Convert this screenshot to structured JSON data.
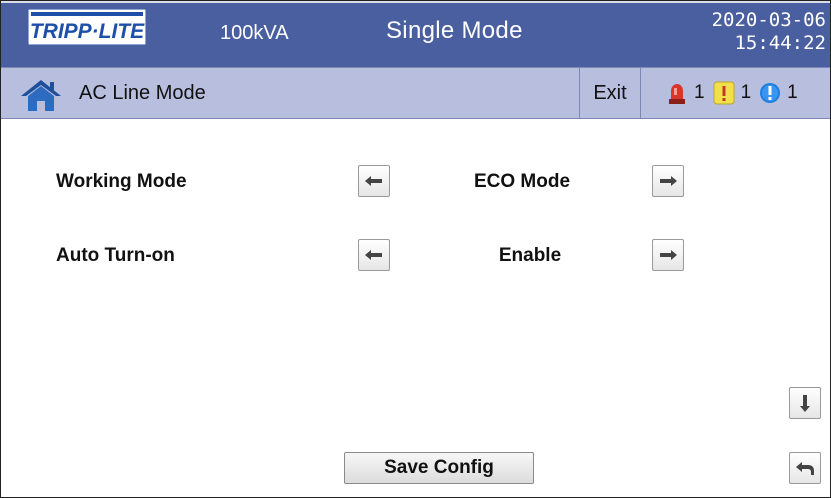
{
  "header": {
    "logo_text": "TRIPP·LITE",
    "model": "100kVA",
    "mode": "Single Mode",
    "date": "2020-03-06",
    "time": "15:44:22"
  },
  "subheader": {
    "title": "AC Line Mode",
    "exit_label": "Exit",
    "alarms": [
      {
        "icon": "red-beacon-icon",
        "count": "1",
        "color": "#d9352c"
      },
      {
        "icon": "yellow-warning-icon",
        "count": "1",
        "color": "#f2e04a"
      },
      {
        "icon": "blue-info-icon",
        "count": "1",
        "color": "#1e7fe0"
      }
    ]
  },
  "settings": [
    {
      "label": "Working Mode",
      "value": "ECO Mode"
    },
    {
      "label": "Auto Turn-on",
      "value": "Enable"
    }
  ],
  "footer": {
    "save_label": "Save Config"
  },
  "colors": {
    "header_bg": "#4a5fa0",
    "subheader_bg": "#b7bede",
    "logo_blue": "#1d4fa8"
  }
}
